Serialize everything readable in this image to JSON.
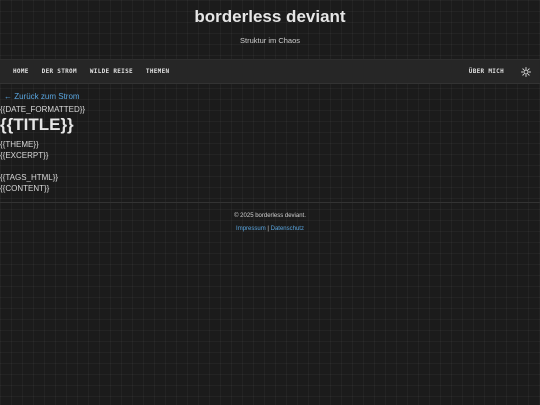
{
  "header": {
    "title": "borderless deviant",
    "subtitle": "Struktur im Chaos"
  },
  "nav": {
    "items": [
      "HOME",
      "DER STROM",
      "WILDE REISE",
      "THEMEN"
    ],
    "about": "ÜBER MICH",
    "theme_toggle_icon": "sun-icon"
  },
  "post": {
    "back_link": "← Zurück zum Strom",
    "date": "{{DATE_FORMATTED}}",
    "title": "{{TITLE}}",
    "theme": "{{THEME}}",
    "excerpt": "{{EXCERPT}}",
    "tags": "{{TAGS_HTML}}",
    "content": "{{CONTENT}}"
  },
  "footer": {
    "copyright": "© 2025 borderless deviant.",
    "impressum": "Impressum",
    "separator": "|",
    "datenschutz": "Datenschutz"
  },
  "colors": {
    "background": "#1b1b1b",
    "nav_background": "#262626",
    "link": "#5aa6e0",
    "text": "#d8d8d8"
  }
}
